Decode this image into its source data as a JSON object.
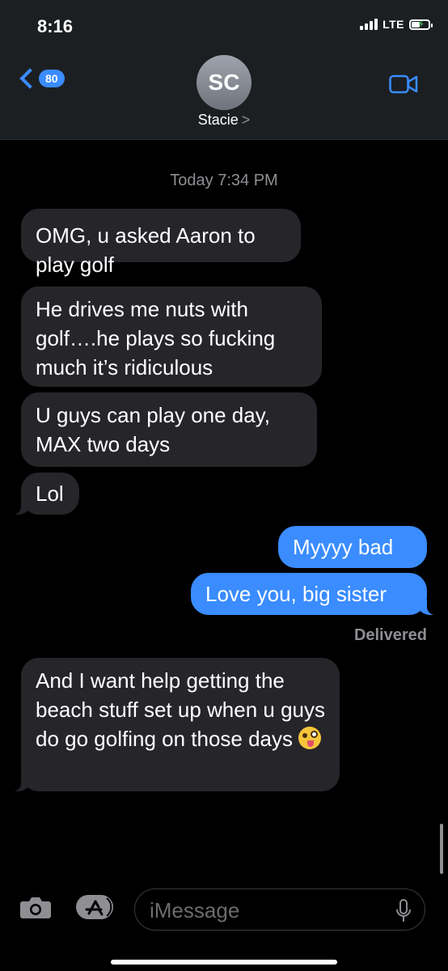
{
  "status_bar": {
    "time": "8:16",
    "network": "LTE"
  },
  "nav": {
    "back_badge": "80",
    "avatar_initials": "SC",
    "contact_name": "Stacie",
    "contact_chevron": ">"
  },
  "conversation": {
    "timestamp": "Today 7:34 PM",
    "messages": [
      {
        "sender": "them",
        "text": "OMG, u asked Aaron to play golf"
      },
      {
        "sender": "them",
        "text": "He drives me nuts with golf….he plays so fucking much it’s ridiculous"
      },
      {
        "sender": "them",
        "text": "U guys can play one day, MAX two days"
      },
      {
        "sender": "them",
        "text": "Lol"
      },
      {
        "sender": "me",
        "text": "Myyyy bad"
      },
      {
        "sender": "me",
        "text": "Love you, big sister"
      },
      {
        "sender": "them",
        "text": "And I want help getting the beach stuff set up when u guys do go golfing on those days",
        "emoji": "zany-face-emoji"
      }
    ],
    "delivered": "Delivered"
  },
  "composer": {
    "placeholder": "iMessage",
    "icons": [
      "camera-icon",
      "app-store-icon",
      "microphone-icon"
    ]
  },
  "colors": {
    "accent": "#3a8cff",
    "incoming_bubble": "#26252a",
    "header_bg": "#1c1f22",
    "secondary_text": "#8e8e93"
  }
}
